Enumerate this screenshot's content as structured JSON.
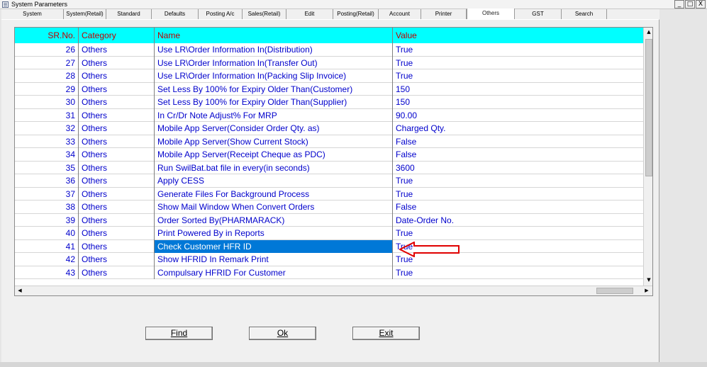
{
  "window": {
    "title": "System Parameters",
    "controls": [
      "_",
      "□",
      "X"
    ]
  },
  "tabs": [
    {
      "label": "System"
    },
    {
      "label": "System(Retail)"
    },
    {
      "label": "Standard"
    },
    {
      "label": "Defaults"
    },
    {
      "label": "Posting A/c"
    },
    {
      "label": "Sales(Retail)"
    },
    {
      "label": "Edit"
    },
    {
      "label": "Posting(Retail)"
    },
    {
      "label": "Account"
    },
    {
      "label": "Printer"
    },
    {
      "label": "Others"
    },
    {
      "label": "GST"
    },
    {
      "label": "Search"
    }
  ],
  "active_tab": "Others",
  "grid": {
    "headers": {
      "sr": "SR.No.",
      "category": "Category",
      "name": "Name",
      "value": "Value"
    },
    "rows": [
      {
        "sr": "26",
        "category": "Others",
        "name": "Use LR\\Order Information In(Distribution)",
        "value": "True"
      },
      {
        "sr": "27",
        "category": "Others",
        "name": "Use LR\\Order Information In(Transfer Out)",
        "value": "True"
      },
      {
        "sr": "28",
        "category": "Others",
        "name": "Use LR\\Order Information In(Packing Slip Invoice)",
        "value": "True"
      },
      {
        "sr": "29",
        "category": "Others",
        "name": "Set Less By 100% for Expiry Older Than(Customer)",
        "value": "150"
      },
      {
        "sr": "30",
        "category": "Others",
        "name": "Set Less By 100% for Expiry Older Than(Supplier)",
        "value": "150"
      },
      {
        "sr": "31",
        "category": "Others",
        "name": "In Cr/Dr Note Adjust% For MRP",
        "value": "90.00"
      },
      {
        "sr": "32",
        "category": "Others",
        "name": "Mobile App Server(Consider Order Qty. as)",
        "value": "Charged Qty."
      },
      {
        "sr": "33",
        "category": "Others",
        "name": "Mobile App Server(Show Current Stock)",
        "value": "False"
      },
      {
        "sr": "34",
        "category": "Others",
        "name": "Mobile App Server(Receipt Cheque as PDC)",
        "value": "False"
      },
      {
        "sr": "35",
        "category": "Others",
        "name": "Run SwilBat.bat file in every(in seconds)",
        "value": "3600"
      },
      {
        "sr": "36",
        "category": "Others",
        "name": "Apply CESS",
        "value": "True"
      },
      {
        "sr": "37",
        "category": "Others",
        "name": "Generate Files For Background Process",
        "value": "True"
      },
      {
        "sr": "38",
        "category": "Others",
        "name": "Show Mail Window When Convert Orders",
        "value": "False"
      },
      {
        "sr": "39",
        "category": "Others",
        "name": "Order Sorted By(PHARMARACK)",
        "value": "Date-Order No."
      },
      {
        "sr": "40",
        "category": "Others",
        "name": "Print Powered By in Reports",
        "value": "True"
      },
      {
        "sr": "41",
        "category": "Others",
        "name": "Check Customer HFR ID",
        "value": "True",
        "selected": true
      },
      {
        "sr": "42",
        "category": "Others",
        "name": "Show HFRID In Remark Print",
        "value": "True"
      },
      {
        "sr": "43",
        "category": "Others",
        "name": "Compulsary HFRID For Customer",
        "value": "True"
      }
    ]
  },
  "buttons": {
    "find": "Find",
    "ok": "Ok",
    "exit": "Exit"
  },
  "colors": {
    "header_bg": "#00ffff",
    "header_text": "#c00000",
    "cell_text": "#0000cc",
    "selection": "#0078d7",
    "annotation": "#e00000"
  },
  "annotation_icon": "red-arrow-icon"
}
